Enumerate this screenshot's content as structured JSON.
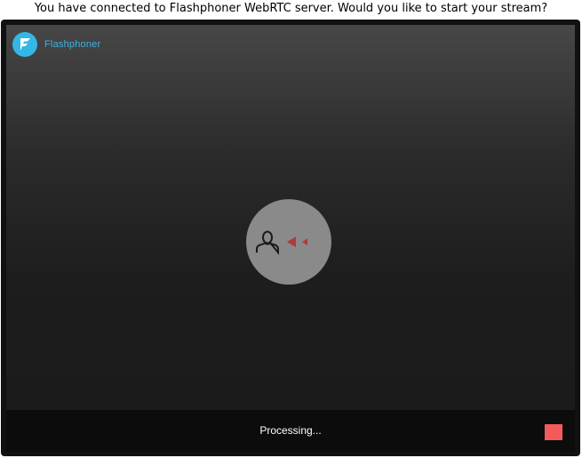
{
  "prompt": {
    "question": "You have connected to Flashphoner WebRTC server. Would you like to start your stream?"
  },
  "player": {
    "logo": {
      "icon": "flashphoner-logo-icon",
      "text": "Flashphoner",
      "color": "#35b7e6"
    },
    "center_indicator": {
      "icons": [
        "user-icon",
        "rewind-arrows-icon"
      ],
      "arrow_color": "#b23a3a"
    },
    "control_bar": {
      "status": "Processing...",
      "stop_button_icon": "stop-square-icon",
      "stop_color": "#f35b5b"
    }
  }
}
